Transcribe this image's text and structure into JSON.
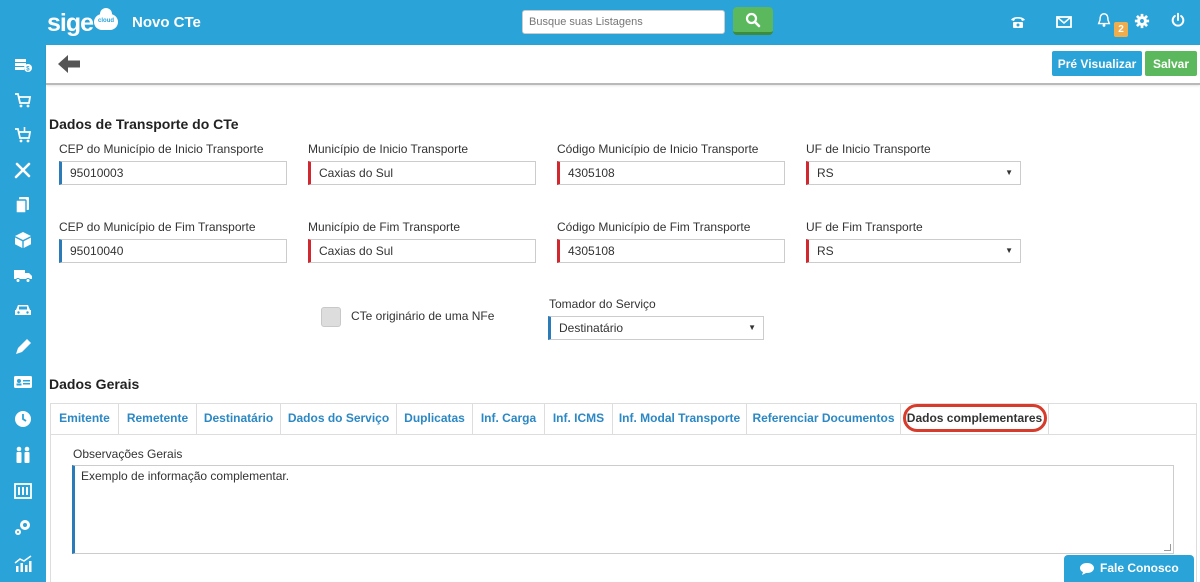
{
  "header": {
    "logo_text": "sige",
    "logo_cloud_text": "cloud",
    "title": "Novo CTe",
    "search_placeholder": "Busque suas Listagens",
    "notification_count": "2"
  },
  "toolbar": {
    "preview_label": "Pré Visualizar",
    "save_label": "Salvar"
  },
  "transport": {
    "title": "Dados de Transporte do CTe",
    "cep_inicio_label": "CEP do Município de Inicio Transporte",
    "cep_inicio_value": "95010003",
    "mun_inicio_label": "Município de Inicio Transporte",
    "mun_inicio_value": "Caxias do Sul",
    "cod_inicio_label": "Código Município de Inicio Transporte",
    "cod_inicio_value": "4305108",
    "uf_inicio_label": "UF de Inicio Transporte",
    "uf_inicio_value": "RS",
    "cep_fim_label": "CEP do Município de Fim Transporte",
    "cep_fim_value": "95010040",
    "mun_fim_label": "Município de Fim Transporte",
    "mun_fim_value": "Caxias do Sul",
    "cod_fim_label": "Código Município de Fim Transporte",
    "cod_fim_value": "4305108",
    "uf_fim_label": "UF de Fim Transporte",
    "uf_fim_value": "RS",
    "nfe_checkbox_label": "CTe originário de uma NFe",
    "tomador_label": "Tomador do Serviço",
    "tomador_value": "Destinatário"
  },
  "general": {
    "title": "Dados Gerais",
    "tabs": [
      {
        "label": "Emitente"
      },
      {
        "label": "Remetente"
      },
      {
        "label": "Destinatário"
      },
      {
        "label": "Dados do Serviço"
      },
      {
        "label": "Duplicatas"
      },
      {
        "label": "Inf. Carga"
      },
      {
        "label": "Inf. ICMS"
      },
      {
        "label": "Inf. Modal Transporte"
      },
      {
        "label": "Referenciar Documentos"
      },
      {
        "label": "Dados complementares"
      }
    ],
    "obs_label": "Observações Gerais",
    "obs_value": "Exemplo de informação complementar."
  },
  "chat": {
    "label": "Fale Conosco"
  },
  "colors": {
    "primary": "#2aa3d8",
    "success": "#5cb85c",
    "required": "#d0282e",
    "tab_link": "#2b88c4",
    "highlight": "#d73b2b"
  }
}
